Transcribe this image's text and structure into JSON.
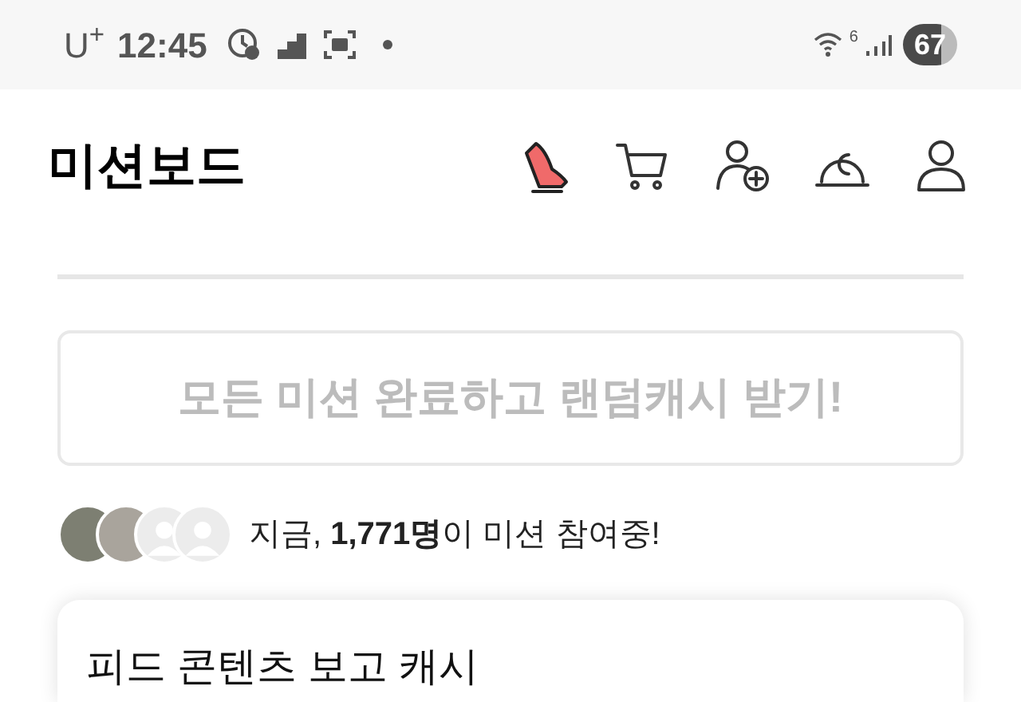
{
  "status_bar": {
    "carrier": "U$^{+}$",
    "time": "12:45",
    "network": "6",
    "battery": "67"
  },
  "header": {
    "title": "미션보드"
  },
  "mission_button": {
    "label": "모든 미션 완료하고 랜덤캐시 받기!",
    "disabled": true
  },
  "participants": {
    "avatars": [
      {
        "kind": "photo"
      },
      {
        "kind": "photo"
      },
      {
        "kind": "placeholder"
      },
      {
        "kind": "placeholder"
      }
    ],
    "text": "지금, **1,771명**이 미션 참여중!"
  },
  "card": {
    "title": "피드 콘텐츠 보고 캐시"
  }
}
